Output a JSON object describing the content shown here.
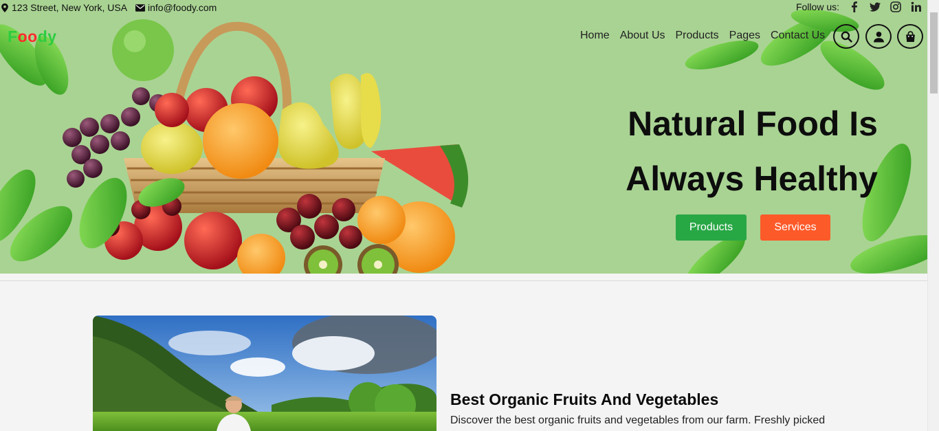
{
  "topbar": {
    "address": "123 Street, New York, USA",
    "email": "info@foody.com",
    "follow_label": "Follow us:",
    "social_icons": [
      "facebook-icon",
      "twitter-icon",
      "instagram-icon",
      "linkedin-icon"
    ]
  },
  "logo": {
    "letters": [
      {
        "char": "F",
        "color": "#2ecc40"
      },
      {
        "char": "o",
        "color": "#ff2a2a"
      },
      {
        "char": "o",
        "color": "#ff2a2a"
      },
      {
        "char": "d",
        "color": "#2ecc40"
      },
      {
        "char": "y",
        "color": "#2ecc40"
      }
    ]
  },
  "nav": {
    "items": [
      "Home",
      "About Us",
      "Products",
      "Pages",
      "Contact Us"
    ],
    "icons": [
      "search-icon",
      "user-icon",
      "shopping-bag-icon"
    ]
  },
  "hero": {
    "title_line1": "Natural Food Is",
    "title_line2": "Always Healthy",
    "button_products": "Products",
    "button_services": "Services"
  },
  "about": {
    "title": "Best Organic Fruits And Vegetables",
    "text": "Discover the best organic fruits and vegetables from our farm. Freshly picked"
  },
  "colors": {
    "hero_bg": "#a9d393",
    "products_button": "#28a745",
    "services_button": "#fd5a29"
  }
}
